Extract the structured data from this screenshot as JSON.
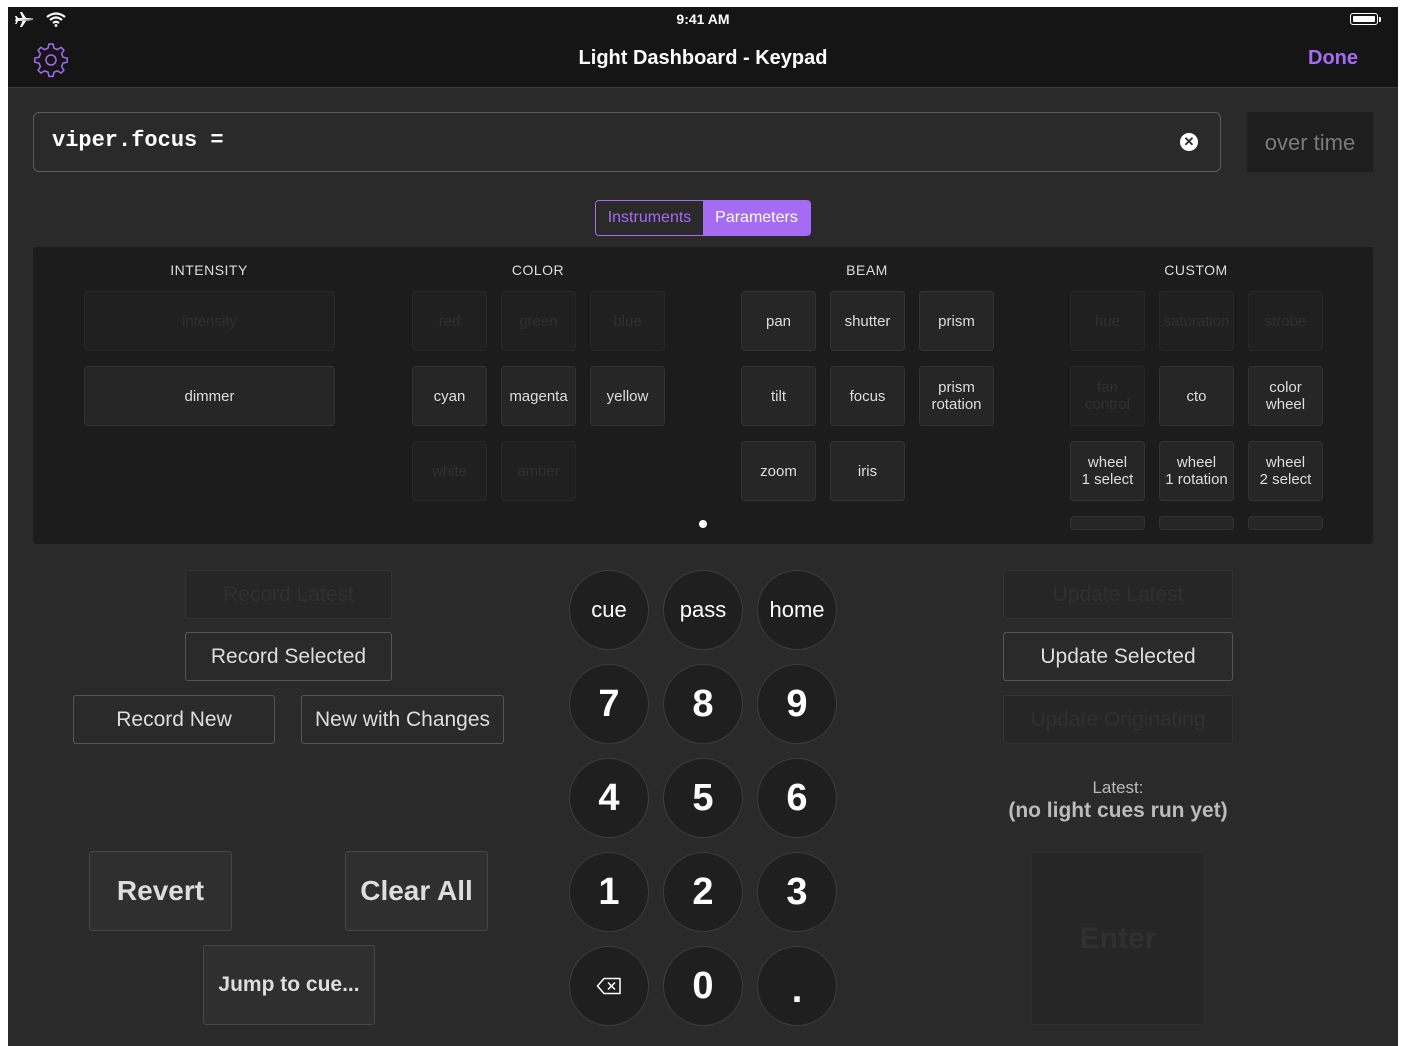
{
  "status": {
    "time": "9:41 AM"
  },
  "header": {
    "title": "Light Dashboard - Keypad",
    "done_label": "Done"
  },
  "command": {
    "text": "viper.focus =",
    "over_time_label": "over time"
  },
  "segments": {
    "instruments": "Instruments",
    "parameters": "Parameters",
    "selected": "Parameters"
  },
  "categories": {
    "intensity": "INTENSITY",
    "color": "COLOR",
    "beam": "BEAM",
    "custom": "CUSTOM"
  },
  "params": {
    "intensity": {
      "intensity": "intensity",
      "dimmer": "dimmer"
    },
    "color": {
      "red": "red",
      "green": "green",
      "blue": "blue",
      "cyan": "cyan",
      "magenta": "magenta",
      "yellow": "yellow",
      "white": "white",
      "amber": "amber"
    },
    "beam": {
      "pan": "pan",
      "shutter": "shutter",
      "prism": "prism",
      "tilt": "tilt",
      "focus": "focus",
      "prism_rotation": "prism\nrotation",
      "zoom": "zoom",
      "iris": "iris"
    },
    "custom": {
      "hue": "hue",
      "saturation": "saturation",
      "strobe": "strobe",
      "fan_control": "fan\ncontrol",
      "cto": "cto",
      "color_wheel": "color\nwheel",
      "wheel1_select": "wheel\n1 select",
      "wheel1_rotation": "wheel\n1 rotation",
      "wheel2_select": "wheel\n2 select"
    }
  },
  "left": {
    "record_latest": "Record Latest",
    "record_selected": "Record Selected",
    "record_new": "Record New",
    "new_with_changes": "New with Changes",
    "revert": "Revert",
    "clear_all": "Clear All",
    "jump_to_cue": "Jump to cue..."
  },
  "keypad": {
    "cue": "cue",
    "pass": "pass",
    "home": "home",
    "k7": "7",
    "k8": "8",
    "k9": "9",
    "k4": "4",
    "k5": "5",
    "k6": "6",
    "k1": "1",
    "k2": "2",
    "k3": "3",
    "k0": "0",
    "dot": "."
  },
  "right": {
    "update_latest": "Update Latest",
    "update_selected": "Update Selected",
    "update_originating": "Update Originating",
    "latest_label": "Latest:",
    "latest_value": "(no light cues run yet)",
    "enter": "Enter"
  },
  "colors": {
    "accent": "#a56bf2",
    "background": "#2a2a2a",
    "topbar": "#151515"
  },
  "icons": {
    "airplane": "airplane-icon",
    "wifi": "wifi-icon",
    "battery": "battery-icon",
    "settings": "gear-icon",
    "clear": "clear-icon",
    "backspace": "backspace-icon"
  }
}
